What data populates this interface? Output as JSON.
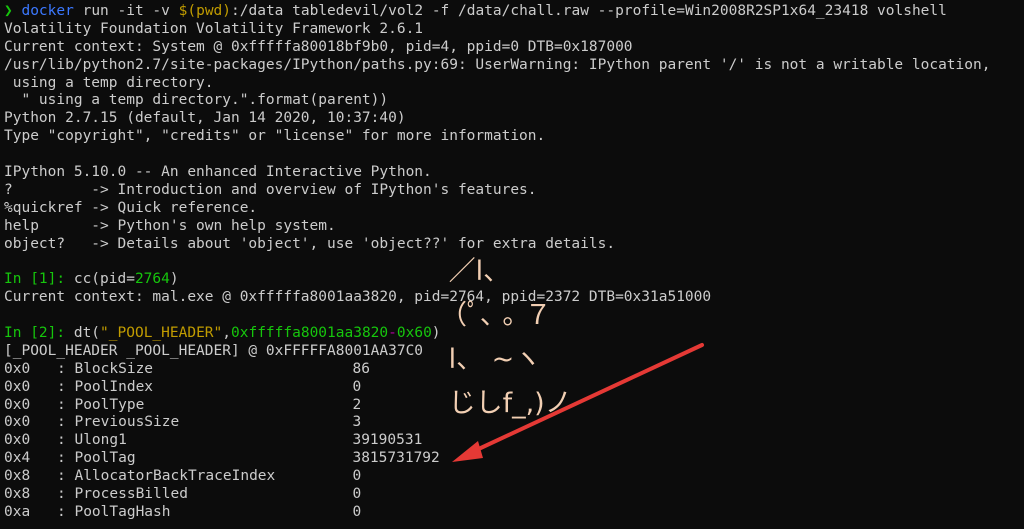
{
  "terminal": {
    "command": {
      "prompt_symbol": "❯",
      "program": "docker",
      "args_before": " run -it -v ",
      "subshell_open": "$(",
      "subshell_cmd": "pwd",
      "subshell_close": ")",
      "args_after": ":/data tabledevil/vol2 -f /data/chall.raw --profile=Win2008R2SP1x64_23418 volshell"
    },
    "banner": [
      "Volatility Foundation Volatility Framework 2.6.1",
      "Current context: System @ 0xfffffa80018bf9b0, pid=4, ppid=0 DTB=0x187000",
      "/usr/lib/python2.7/site-packages/IPython/paths.py:69: UserWarning: IPython parent '/' is not a writable location,",
      " using a temp directory.",
      "  \" using a temp directory.\".format(parent))",
      "Python 2.7.15 (default, Jan 14 2020, 10:37:40)",
      "Type \"copyright\", \"credits\" or \"license\" for more information.",
      "",
      "IPython 5.10.0 -- An enhanced Interactive Python.",
      "?         -> Introduction and overview of IPython's features.",
      "%quickref -> Quick reference.",
      "help      -> Python's own help system.",
      "object?   -> Details about 'object', use 'object??' for extra details.",
      ""
    ],
    "in1": {
      "label": "In [1]: ",
      "func": "cc(pid=",
      "arg": "2764",
      "close": ")",
      "output": "Current context: mal.exe @ 0xfffffa8001aa3820, pid=2764, ppid=2372 DTB=0x31a51000",
      "blank": ""
    },
    "in2": {
      "label": "In [2]: ",
      "func": "dt(",
      "str_arg": "\"_POOL_HEADER\"",
      "comma": ",",
      "addr": "0xfffffa8001aa3820",
      "minus": "-",
      "offset": "0x60",
      "close": ")",
      "header": "[_POOL_HEADER _POOL_HEADER] @ 0xFFFFFA8001AA37C0"
    },
    "fields": [
      {
        "offset": "0x0",
        "name": "BlockSize",
        "value": "86"
      },
      {
        "offset": "0x0",
        "name": "PoolIndex",
        "value": "0"
      },
      {
        "offset": "0x0",
        "name": "PoolType",
        "value": "2"
      },
      {
        "offset": "0x0",
        "name": "PreviousSize",
        "value": "3"
      },
      {
        "offset": "0x0",
        "name": "Ulong1",
        "value": "39190531"
      },
      {
        "offset": "0x4",
        "name": "PoolTag",
        "value": "3815731792"
      },
      {
        "offset": "0x8",
        "name": "AllocatorBackTraceIndex",
        "value": "0"
      },
      {
        "offset": "0x8",
        "name": "ProcessBilled",
        "value": "0"
      },
      {
        "offset": "0xa",
        "name": "PoolTagHash",
        "value": "0"
      }
    ]
  },
  "annotation": {
    "ascii_art": [
      " ／l、",
      "（ﾟ､ ｡ ７",
      " l、 ~ヽ",
      " じしf_,)ノ"
    ],
    "arrow_color": "#e53935"
  }
}
